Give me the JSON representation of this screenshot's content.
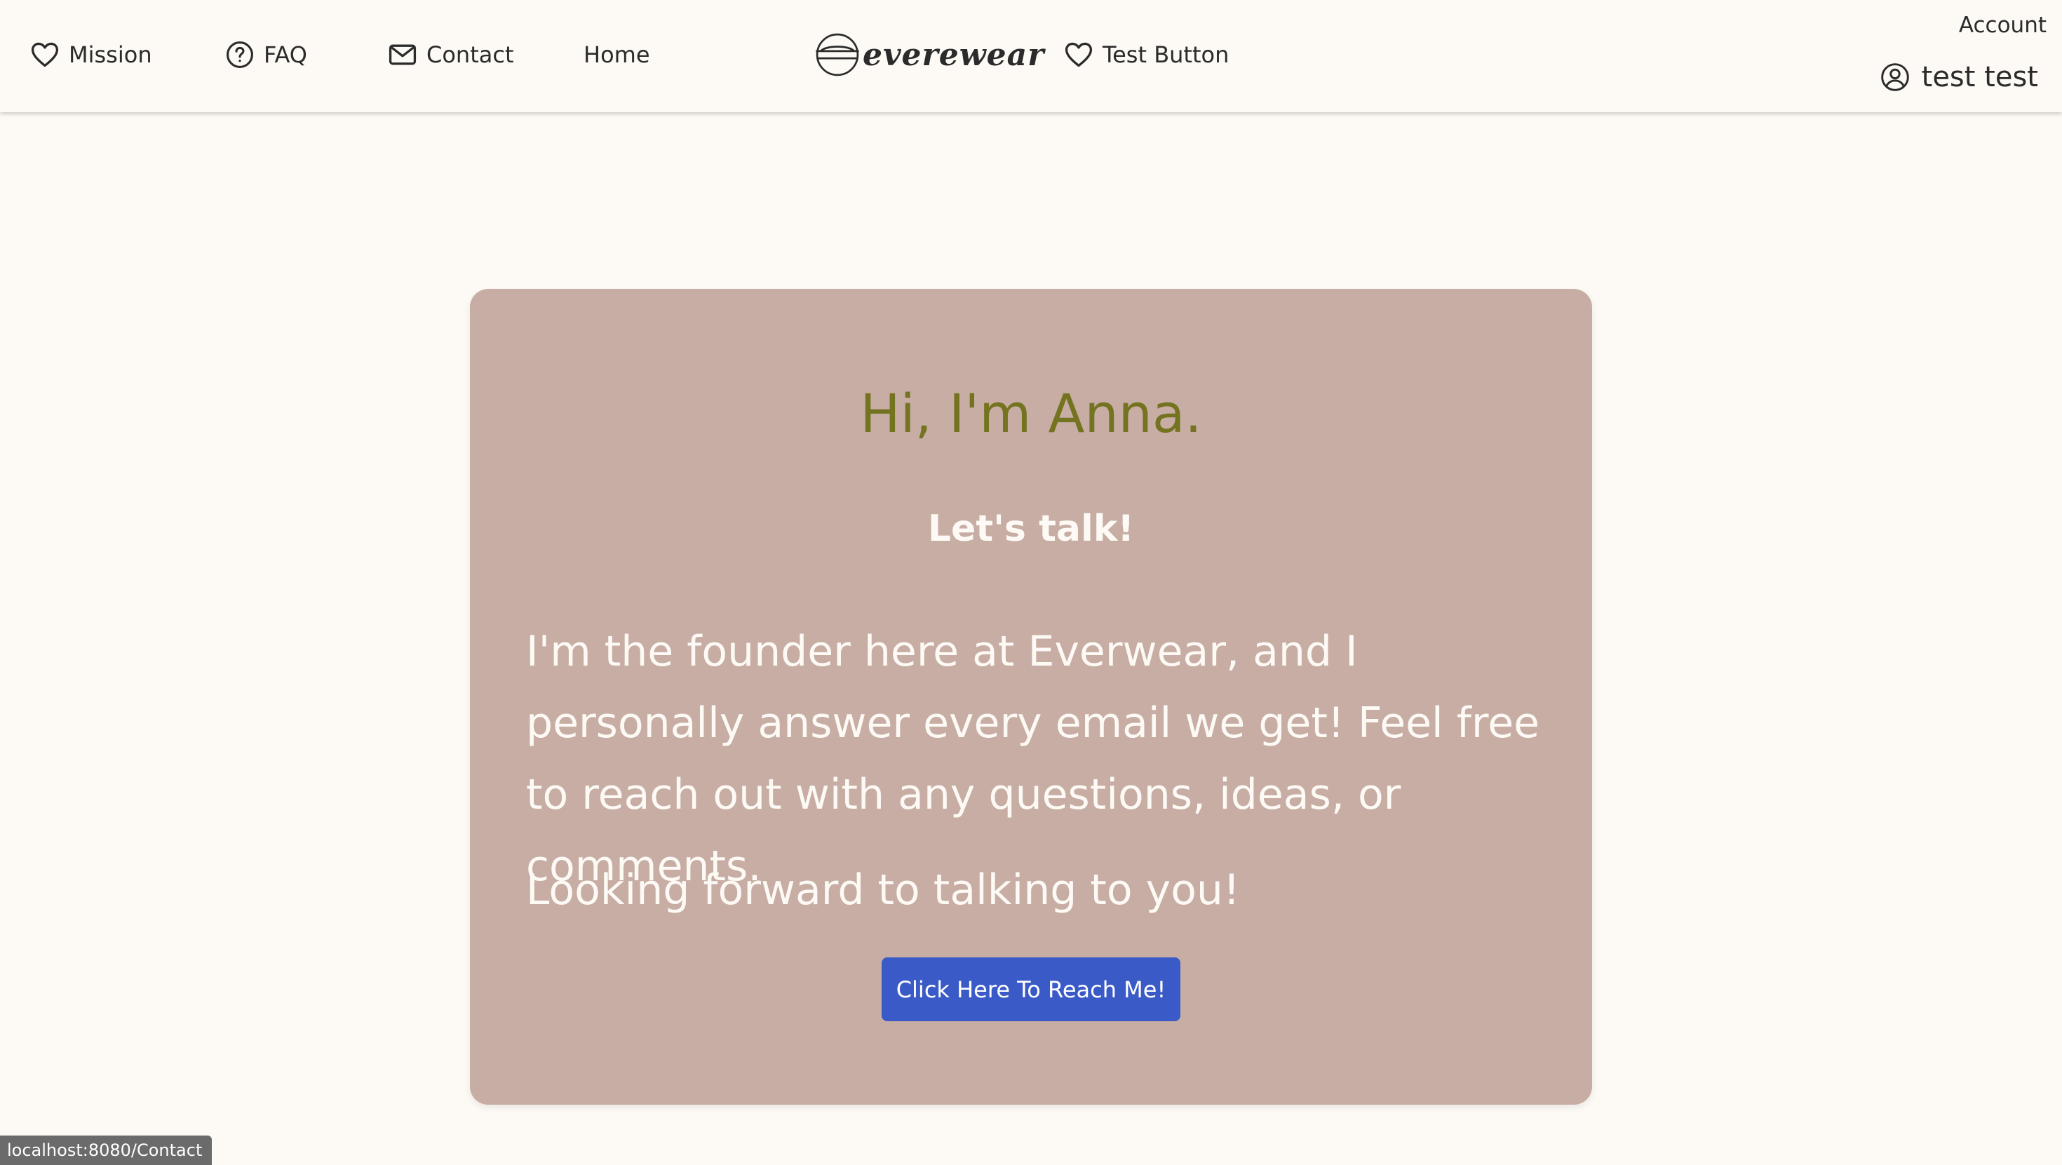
{
  "header": {
    "nav": {
      "mission": "Mission",
      "faq": "FAQ",
      "contact": "Contact",
      "home": "Home",
      "test": "Test Button"
    },
    "logo_text": "everewear",
    "account_label": "Account",
    "user_name": "test test"
  },
  "card": {
    "title": "Hi, I'm Anna.",
    "subtitle": "Let's talk!",
    "body": "I'm the founder here at Everwear, and I personally answer every email we get! Feel free to reach out with any questions, ideas, or comments.",
    "closing": "Looking forward to talking to you!",
    "button_label": "Click Here To Reach Me!"
  },
  "status_bar": {
    "url": "localhost:8080/Contact"
  },
  "colors": {
    "page_background": "#fdfaf5",
    "card_background": "#c7ada3",
    "title_color": "#747320",
    "button_background": "#3a5bc7",
    "text_dark": "#2b2b2b",
    "text_light": "#fdfaf5"
  },
  "icons": {
    "mission": "heart-icon",
    "faq": "question-circle-icon",
    "contact": "envelope-icon",
    "test": "heart-icon",
    "user": "user-circle-icon",
    "logo": "logo-mark-icon"
  }
}
